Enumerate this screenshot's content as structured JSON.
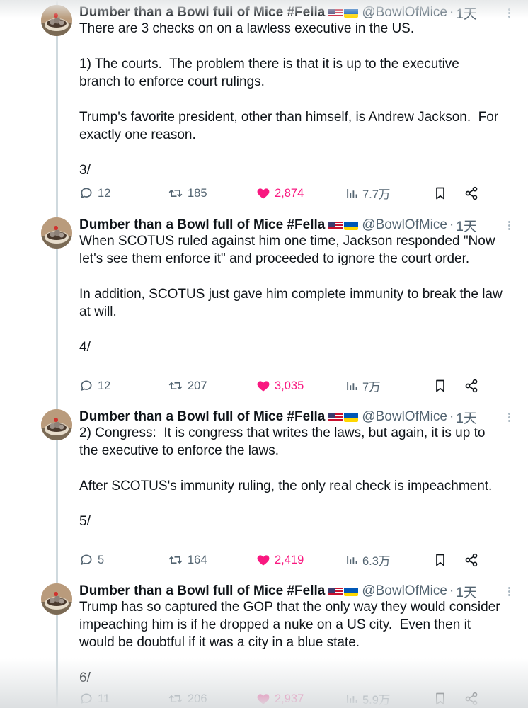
{
  "author": {
    "name": "Dumber than a Bowl full of Mice #Fella",
    "handle": "@BowlOfMice",
    "separator": "·",
    "time": "1天",
    "flags": [
      "us-flag-icon",
      "ukraine-flag-icon"
    ]
  },
  "colors": {
    "like": "#f91880",
    "muted": "#536471",
    "thread_line": "#cfd9de"
  },
  "tweets": [
    {
      "text": "There are 3 checks on on a lawless executive in the US.\n\n1) The courts.  The problem there is that it is up to the executive branch to enforce court rulings.\n\nTrump's favorite president, other than himself, is Andrew Jackson.  For exactly one reason.\n\n3/",
      "replies": "12",
      "retweets": "185",
      "likes": "2,874",
      "views": "7.7万"
    },
    {
      "text": "When SCOTUS ruled against him one time, Jackson responded \"Now let's see them enforce it\" and proceeded to ignore the court order.\n\nIn addition, SCOTUS just gave him complete immunity to break the law at will.\n\n4/",
      "replies": "12",
      "retweets": "207",
      "likes": "3,035",
      "views": "7万"
    },
    {
      "text": "2) Congress:  It is congress that writes the laws, but again, it is up to the executive to enforce the laws.\n\nAfter SCOTUS's immunity ruling, the only real check is impeachment.\n\n5/",
      "replies": "5",
      "retweets": "164",
      "likes": "2,419",
      "views": "6.3万"
    },
    {
      "text": "Trump has so captured the GOP that the only way they would consider impeaching him is if he dropped a nuke on a US city.  Even then it would be doubtful if it was a city in a blue state.\n\n6/",
      "replies": "11",
      "retweets": "206",
      "likes": "2,937",
      "views": "5.9万"
    }
  ]
}
